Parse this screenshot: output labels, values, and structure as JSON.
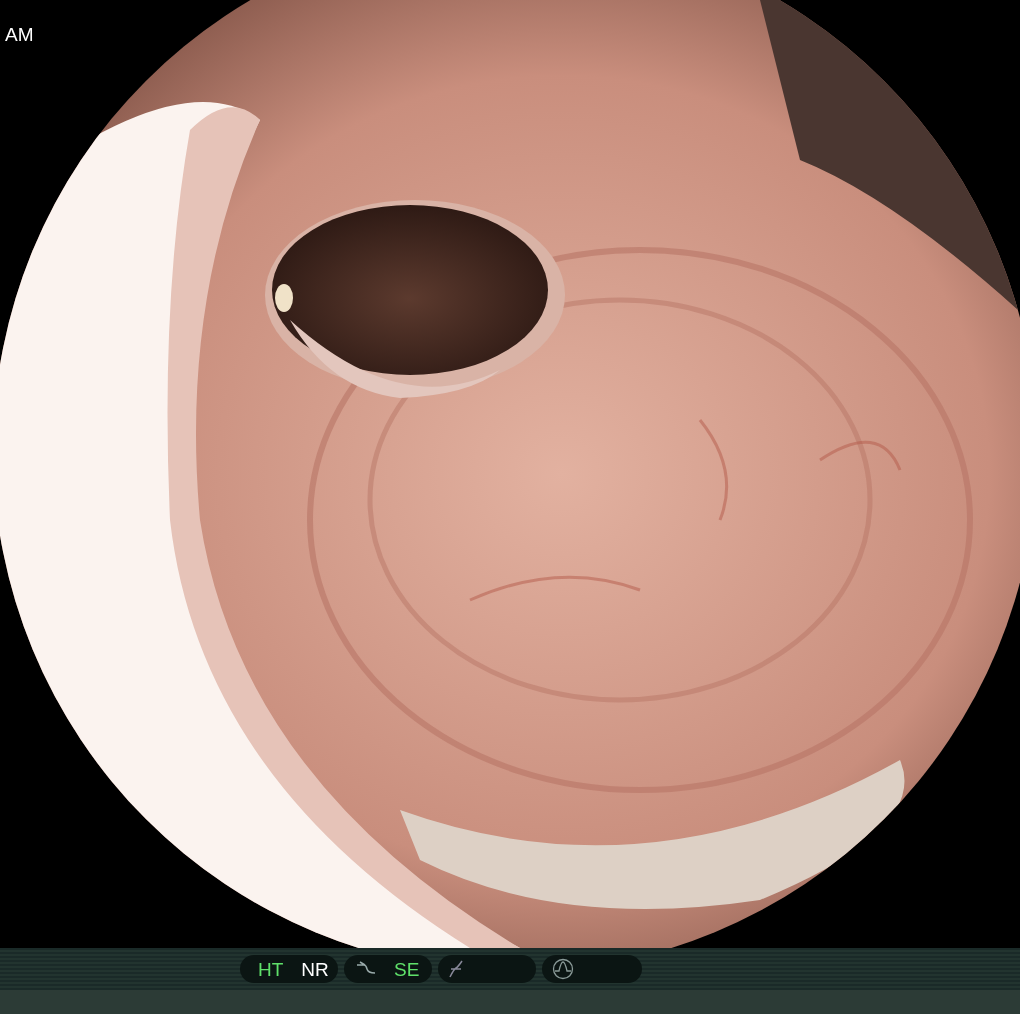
{
  "overlay": {
    "time_suffix": "AM"
  },
  "status_bar": {
    "indicators": [
      {
        "kind": "text",
        "label": "HT",
        "on": true
      },
      {
        "kind": "text",
        "label": "NR",
        "on": false
      },
      {
        "kind": "curve",
        "label": "SE",
        "on": true
      },
      {
        "kind": "slash"
      },
      {
        "kind": "wave"
      }
    ]
  }
}
